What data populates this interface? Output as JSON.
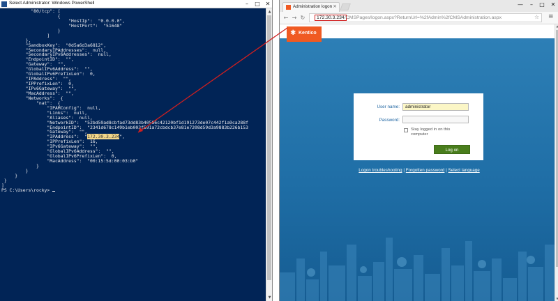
{
  "powershell": {
    "title": "Select Administrator: Windows PowerShell",
    "lines": [
      "           \"80/tcp\": [",
      "                     {",
      "                         \"HostIp\":  \"0.0.0.0\",",
      "                         \"HostPort\":  \"51648\"",
      "                     }",
      "                 ]",
      "         },",
      "         \"SandboxKey\":  \"0d5a6d3a6812\",",
      "         \"SecondaryIPAddresses\":  null,",
      "         \"SecondaryIPv6Addresses\":  null,",
      "         \"EndpointID\":  \"\",",
      "         \"Gateway\":  \"\",",
      "         \"GlobalIPv6Address\":  \"\",",
      "         \"GlobalIPv6PrefixLen\":  0,",
      "         \"IPAddress\":  \"\",",
      "         \"IPPrefixLen\":  0,",
      "         \"IPv6Gateway\":  \"\",",
      "         \"MacAddress\":  \"\",",
      "         \"Networks\":  {",
      "             \"nat\":  {",
      "                 \"IPAMConfig\":  null,",
      "                 \"Links\":  null,",
      "                 \"Aliases\":  null,",
      "                 \"NetworkID\":  \"52bd59ad8cbfad73dd83b40586c42120bf1d191273de07c442f1a9ca288f",
      "                 \"EndpointID\":  \"2341d678c149b1eb003f591a72cbdcb37e81e7208d59d3a9883b226b153",
      "                 \"Gateway\":  \"\","
    ],
    "ip_prefix": "                 \"IPAddress\":  \"",
    "ip_value": "172.30.3.234",
    "ip_suffix": "\",",
    "lines_after": [
      "                 \"IPPrefixLen\":  16,",
      "                 \"IPv6Gateway\":  \"\",",
      "                 \"GlobalIPv6Address\":  \"\",",
      "                 \"GlobalIPv6PrefixLen\":  0,",
      "                 \"MacAddress\":  \"00:15:5d:00:03:b0\"",
      "             }",
      "         }",
      "     }",
      " }",
      "]",
      "PS C:\\Users\\rocky> "
    ]
  },
  "browser": {
    "tab_title": "Administration logon",
    "url_host": "172.30.3.234",
    "url_path": "/CMSPages/logon.aspx?ReturnUrl=%2fAdmin%2fCMSAdministration.aspx",
    "logo_text": "Kentico",
    "form": {
      "username_label": "User name:",
      "username_value": "administrator",
      "password_label": "Password:",
      "password_value": "",
      "remember_label": "Stay logged in on this computer",
      "login_button": "Log on"
    },
    "links": {
      "troubleshooting": "Logon troubleshooting",
      "forgot_password": "Forgotten password",
      "select_language": "Select language",
      "separator": " | "
    }
  },
  "colors": {
    "powershell_bg": "#012456",
    "highlight": "#f3d78a",
    "annotation": "#d01f1f",
    "brand": "#f05a22",
    "login_button": "#497d1c"
  }
}
